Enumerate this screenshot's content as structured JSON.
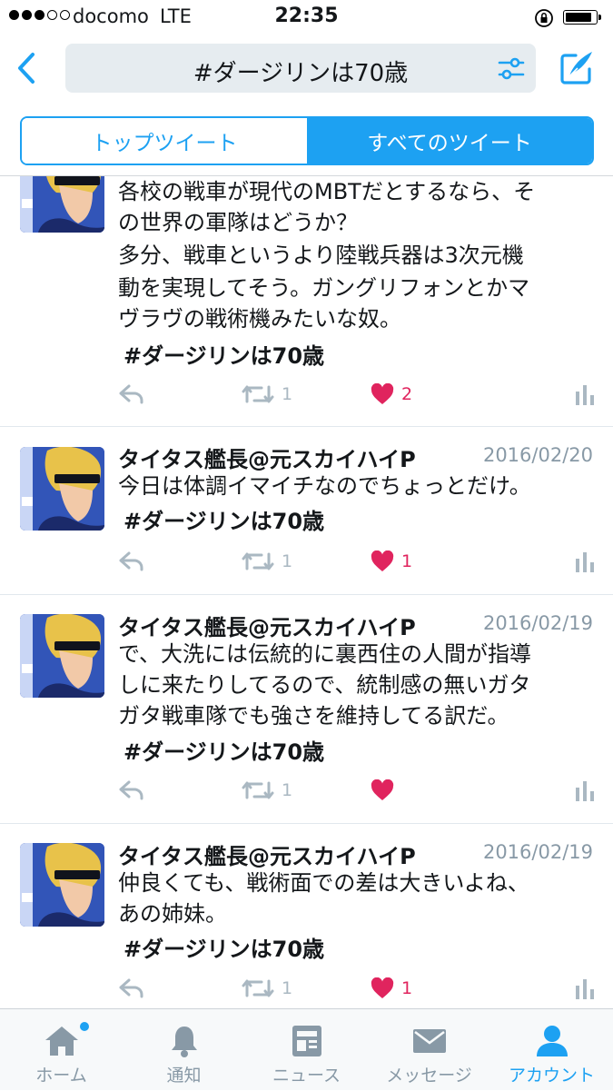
{
  "status_bar": {
    "carrier": "docomo",
    "network": "LTE",
    "time": "22:35"
  },
  "search": {
    "query": "#ダージリンは70歳"
  },
  "segments": {
    "top": "トップツイート",
    "all": "すべてのツイート",
    "selected": "all"
  },
  "tweets": [
    {
      "name": "",
      "date": "",
      "lines": [
        "各校の戦車が現代のMBTだとするなら、そ",
        "の世界の軍隊はどうか？",
        "多分、戦車というより陸戦兵器は3次元機",
        "動を実現してそう。ガングリフォンとかマ",
        "ヴラヴの戦術機みたいな奴。"
      ],
      "hashtag": "#ダージリンは70歳",
      "retweets": "1",
      "likes": "2"
    },
    {
      "name": "タイタス艦長@元スカイハイP",
      "date": "2016/02/20",
      "lines": [
        "今日は体調イマイチなのでちょっとだけ。"
      ],
      "hashtag": "#ダージリンは70歳",
      "retweets": "1",
      "likes": "1"
    },
    {
      "name": "タイタス艦長@元スカイハイP",
      "date": "2016/02/19",
      "lines": [
        "で、大洗には伝統的に裏西住の人間が指導",
        "しに来たりしてるので、統制感の無いガタ",
        "ガタ戦車隊でも強さを維持してる訳だ。"
      ],
      "hashtag": "#ダージリンは70歳",
      "retweets": "1",
      "likes": ""
    },
    {
      "name": "タイタス艦長@元スカイハイP",
      "date": "2016/02/19",
      "lines": [
        "仲良くても、戦術面での差は大きいよね、",
        "あの姉妹。"
      ],
      "hashtag": "#ダージリンは70歳",
      "retweets": "1",
      "likes": "1"
    }
  ],
  "tab_bar": {
    "home": "ホーム",
    "notifications": "通知",
    "news": "ニュース",
    "messages": "メッセージ",
    "account": "アカウント",
    "active": "account"
  },
  "colors": {
    "accent": "#1da1f2",
    "like": "#e0245e",
    "muted": "#aab8c2",
    "text": "#14171a"
  }
}
